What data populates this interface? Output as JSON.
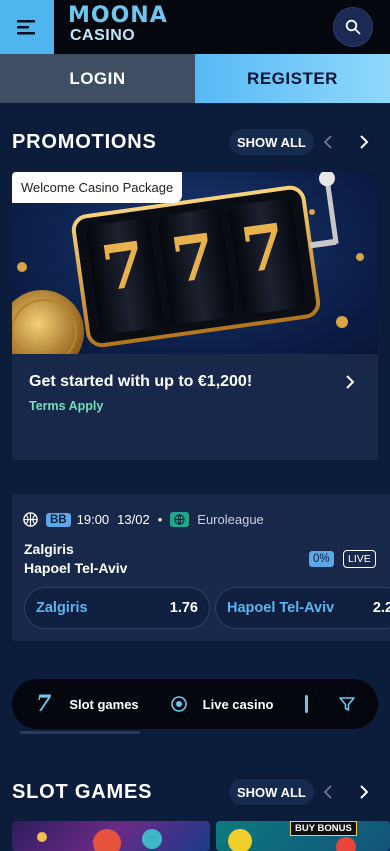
{
  "header": {
    "logo_top": "MOONA",
    "logo_bottom": "CASINO",
    "menu_icon": "hamburger-icon",
    "search_icon": "search-icon"
  },
  "auth": {
    "login_label": "LOGIN",
    "register_label": "REGISTER"
  },
  "promotions": {
    "title": "PROMOTIONS",
    "show_all": "SHOW ALL",
    "card": {
      "chip": "Welcome Casino Package",
      "slot_digits": [
        "7",
        "7",
        "7"
      ],
      "headline": "Get started with up to €1,200!",
      "terms": "Terms Apply"
    }
  },
  "match": {
    "sport_badge": "BB",
    "time": "19:00",
    "date": "13/02",
    "separator": "•",
    "league": "Euroleague",
    "home_team": "Zalgiris",
    "away_team": "Hapoel Tel-Aviv",
    "percent": "0%",
    "live_label": "LIVE",
    "odds": [
      {
        "team": "Zalgiris",
        "price": "1.76"
      },
      {
        "team": "Hapoel Tel-Aviv",
        "price": "2.2"
      }
    ]
  },
  "categories": {
    "slot_count": "7",
    "slot_label": "Slot games",
    "live_label": "Live casino"
  },
  "slot_games": {
    "title": "SLOT GAMES",
    "show_all": "SHOW ALL",
    "thumb_badge": "BUY BONUS"
  },
  "colors": {
    "accent": "#4fb5ef",
    "background": "#0b1d3b",
    "card": "#17284a",
    "terms": "#73e0b8"
  }
}
